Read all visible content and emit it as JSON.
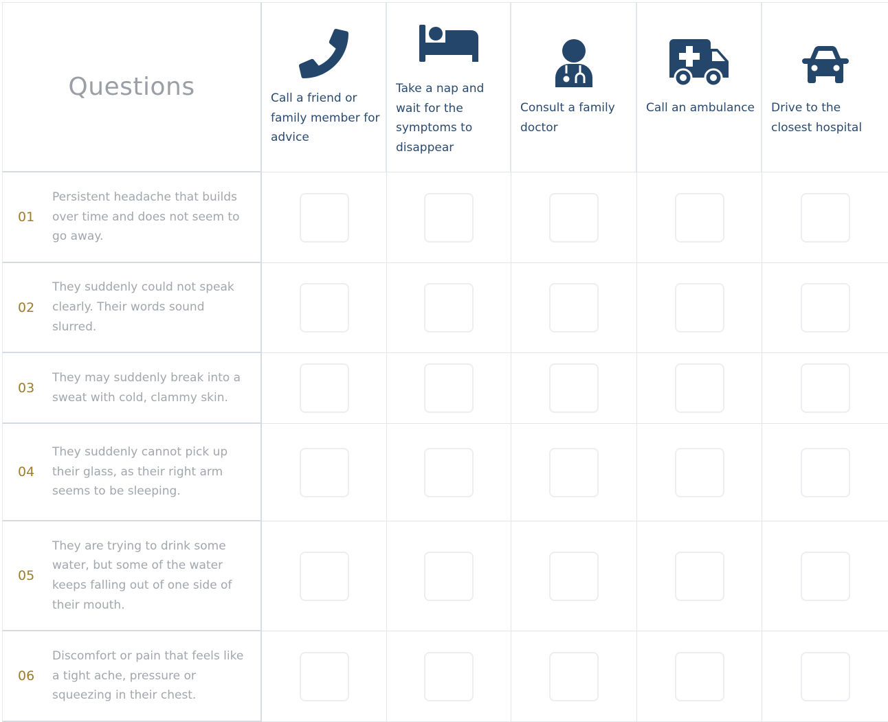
{
  "header": {
    "questions_title": "Questions"
  },
  "options": [
    {
      "label": "Call a friend or family member for advice",
      "icon": "phone-icon"
    },
    {
      "label": "Take a nap and wait for the symptoms to disappear",
      "icon": "bed-icon"
    },
    {
      "label": "Consult a family doctor",
      "icon": "doctor-icon"
    },
    {
      "label": "Call an ambulance",
      "icon": "ambulance-icon"
    },
    {
      "label": "Drive to the closest hospital",
      "icon": "car-icon"
    }
  ],
  "questions": [
    {
      "number": "01",
      "text": "Persistent headache that builds over time and does not seem to go away.",
      "answers": [
        false,
        false,
        false,
        false,
        false
      ]
    },
    {
      "number": "02",
      "text": "They suddenly could not speak clearly. Their words sound slurred.",
      "answers": [
        false,
        false,
        false,
        false,
        false
      ]
    },
    {
      "number": "03",
      "text": "They may suddenly break into a sweat with cold, clammy skin.",
      "answers": [
        false,
        false,
        false,
        false,
        false
      ]
    },
    {
      "number": "04",
      "text": "They suddenly cannot pick up their glass, as their right arm seems to be sleeping.",
      "answers": [
        false,
        false,
        false,
        false,
        false
      ]
    },
    {
      "number": "05",
      "text": "They are trying to drink some water, but some of the water keeps falling out of one side of their mouth.",
      "answers": [
        false,
        false,
        false,
        false,
        false
      ]
    },
    {
      "number": "06",
      "text": "Discomfort or pain that feels like a tight ache, pressure or squeezing in their chest.",
      "answers": [
        false,
        false,
        false,
        false,
        false
      ]
    }
  ],
  "colors": {
    "icon": "#24466b",
    "option_label": "#2a4a70",
    "question_number": "#9c7d28",
    "question_text": "#a2a6ad",
    "grid_line": "#e2e5ea"
  }
}
